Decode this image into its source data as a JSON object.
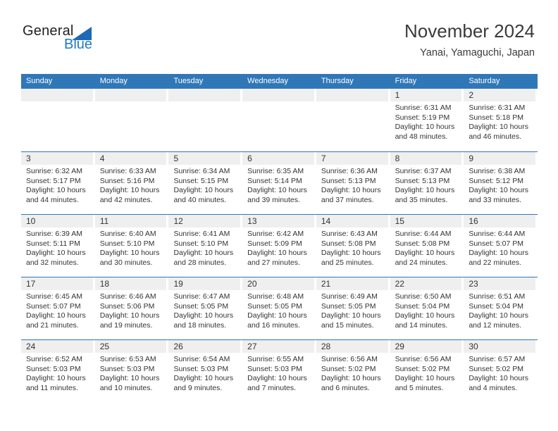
{
  "brand": {
    "name_top": "General",
    "name_bottom": "Blue",
    "triangle_color": "#1d6ab5",
    "blue_text_color": "#1f7ac7"
  },
  "header": {
    "title": "November 2024",
    "subtitle": "Yanai, Yamaguchi, Japan"
  },
  "theme": {
    "header_blue": "#3077b8",
    "daynum_band": "#efefef",
    "text": "#333333"
  },
  "weekdays": [
    "Sunday",
    "Monday",
    "Tuesday",
    "Wednesday",
    "Thursday",
    "Friday",
    "Saturday"
  ],
  "weeks": [
    [
      {
        "day": "",
        "sunrise": "",
        "sunset": "",
        "daylight": ""
      },
      {
        "day": "",
        "sunrise": "",
        "sunset": "",
        "daylight": ""
      },
      {
        "day": "",
        "sunrise": "",
        "sunset": "",
        "daylight": ""
      },
      {
        "day": "",
        "sunrise": "",
        "sunset": "",
        "daylight": ""
      },
      {
        "day": "",
        "sunrise": "",
        "sunset": "",
        "daylight": ""
      },
      {
        "day": "1",
        "sunrise": "Sunrise: 6:31 AM",
        "sunset": "Sunset: 5:19 PM",
        "daylight": "Daylight: 10 hours and 48 minutes."
      },
      {
        "day": "2",
        "sunrise": "Sunrise: 6:31 AM",
        "sunset": "Sunset: 5:18 PM",
        "daylight": "Daylight: 10 hours and 46 minutes."
      }
    ],
    [
      {
        "day": "3",
        "sunrise": "Sunrise: 6:32 AM",
        "sunset": "Sunset: 5:17 PM",
        "daylight": "Daylight: 10 hours and 44 minutes."
      },
      {
        "day": "4",
        "sunrise": "Sunrise: 6:33 AM",
        "sunset": "Sunset: 5:16 PM",
        "daylight": "Daylight: 10 hours and 42 minutes."
      },
      {
        "day": "5",
        "sunrise": "Sunrise: 6:34 AM",
        "sunset": "Sunset: 5:15 PM",
        "daylight": "Daylight: 10 hours and 40 minutes."
      },
      {
        "day": "6",
        "sunrise": "Sunrise: 6:35 AM",
        "sunset": "Sunset: 5:14 PM",
        "daylight": "Daylight: 10 hours and 39 minutes."
      },
      {
        "day": "7",
        "sunrise": "Sunrise: 6:36 AM",
        "sunset": "Sunset: 5:13 PM",
        "daylight": "Daylight: 10 hours and 37 minutes."
      },
      {
        "day": "8",
        "sunrise": "Sunrise: 6:37 AM",
        "sunset": "Sunset: 5:13 PM",
        "daylight": "Daylight: 10 hours and 35 minutes."
      },
      {
        "day": "9",
        "sunrise": "Sunrise: 6:38 AM",
        "sunset": "Sunset: 5:12 PM",
        "daylight": "Daylight: 10 hours and 33 minutes."
      }
    ],
    [
      {
        "day": "10",
        "sunrise": "Sunrise: 6:39 AM",
        "sunset": "Sunset: 5:11 PM",
        "daylight": "Daylight: 10 hours and 32 minutes."
      },
      {
        "day": "11",
        "sunrise": "Sunrise: 6:40 AM",
        "sunset": "Sunset: 5:10 PM",
        "daylight": "Daylight: 10 hours and 30 minutes."
      },
      {
        "day": "12",
        "sunrise": "Sunrise: 6:41 AM",
        "sunset": "Sunset: 5:10 PM",
        "daylight": "Daylight: 10 hours and 28 minutes."
      },
      {
        "day": "13",
        "sunrise": "Sunrise: 6:42 AM",
        "sunset": "Sunset: 5:09 PM",
        "daylight": "Daylight: 10 hours and 27 minutes."
      },
      {
        "day": "14",
        "sunrise": "Sunrise: 6:43 AM",
        "sunset": "Sunset: 5:08 PM",
        "daylight": "Daylight: 10 hours and 25 minutes."
      },
      {
        "day": "15",
        "sunrise": "Sunrise: 6:44 AM",
        "sunset": "Sunset: 5:08 PM",
        "daylight": "Daylight: 10 hours and 24 minutes."
      },
      {
        "day": "16",
        "sunrise": "Sunrise: 6:44 AM",
        "sunset": "Sunset: 5:07 PM",
        "daylight": "Daylight: 10 hours and 22 minutes."
      }
    ],
    [
      {
        "day": "17",
        "sunrise": "Sunrise: 6:45 AM",
        "sunset": "Sunset: 5:07 PM",
        "daylight": "Daylight: 10 hours and 21 minutes."
      },
      {
        "day": "18",
        "sunrise": "Sunrise: 6:46 AM",
        "sunset": "Sunset: 5:06 PM",
        "daylight": "Daylight: 10 hours and 19 minutes."
      },
      {
        "day": "19",
        "sunrise": "Sunrise: 6:47 AM",
        "sunset": "Sunset: 5:05 PM",
        "daylight": "Daylight: 10 hours and 18 minutes."
      },
      {
        "day": "20",
        "sunrise": "Sunrise: 6:48 AM",
        "sunset": "Sunset: 5:05 PM",
        "daylight": "Daylight: 10 hours and 16 minutes."
      },
      {
        "day": "21",
        "sunrise": "Sunrise: 6:49 AM",
        "sunset": "Sunset: 5:05 PM",
        "daylight": "Daylight: 10 hours and 15 minutes."
      },
      {
        "day": "22",
        "sunrise": "Sunrise: 6:50 AM",
        "sunset": "Sunset: 5:04 PM",
        "daylight": "Daylight: 10 hours and 14 minutes."
      },
      {
        "day": "23",
        "sunrise": "Sunrise: 6:51 AM",
        "sunset": "Sunset: 5:04 PM",
        "daylight": "Daylight: 10 hours and 12 minutes."
      }
    ],
    [
      {
        "day": "24",
        "sunrise": "Sunrise: 6:52 AM",
        "sunset": "Sunset: 5:03 PM",
        "daylight": "Daylight: 10 hours and 11 minutes."
      },
      {
        "day": "25",
        "sunrise": "Sunrise: 6:53 AM",
        "sunset": "Sunset: 5:03 PM",
        "daylight": "Daylight: 10 hours and 10 minutes."
      },
      {
        "day": "26",
        "sunrise": "Sunrise: 6:54 AM",
        "sunset": "Sunset: 5:03 PM",
        "daylight": "Daylight: 10 hours and 9 minutes."
      },
      {
        "day": "27",
        "sunrise": "Sunrise: 6:55 AM",
        "sunset": "Sunset: 5:03 PM",
        "daylight": "Daylight: 10 hours and 7 minutes."
      },
      {
        "day": "28",
        "sunrise": "Sunrise: 6:56 AM",
        "sunset": "Sunset: 5:02 PM",
        "daylight": "Daylight: 10 hours and 6 minutes."
      },
      {
        "day": "29",
        "sunrise": "Sunrise: 6:56 AM",
        "sunset": "Sunset: 5:02 PM",
        "daylight": "Daylight: 10 hours and 5 minutes."
      },
      {
        "day": "30",
        "sunrise": "Sunrise: 6:57 AM",
        "sunset": "Sunset: 5:02 PM",
        "daylight": "Daylight: 10 hours and 4 minutes."
      }
    ]
  ]
}
